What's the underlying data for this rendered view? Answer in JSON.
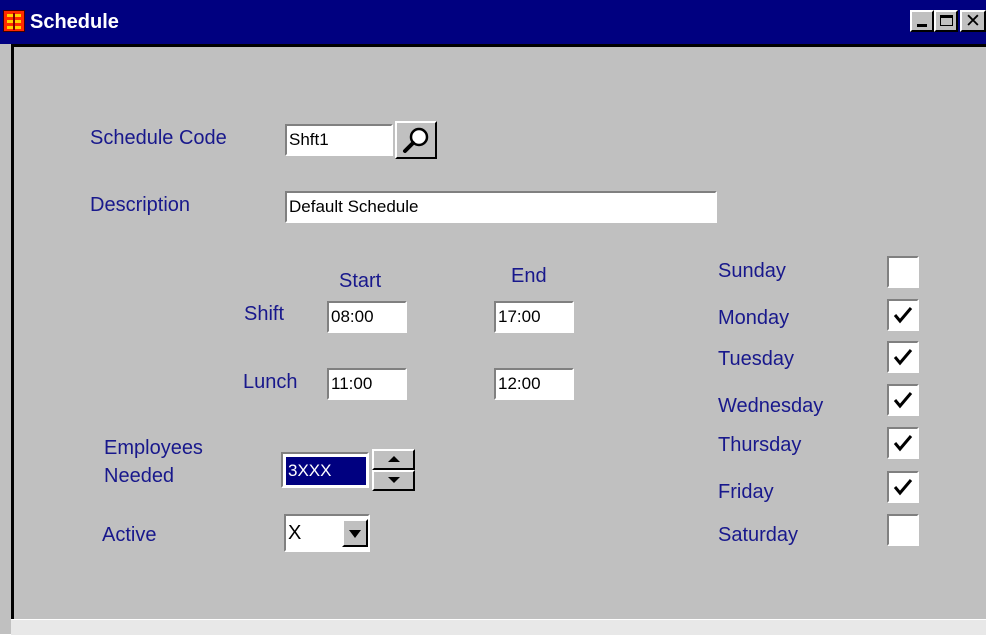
{
  "window": {
    "title": "Schedule",
    "title_bg": "#000080",
    "minimize_glyph": "minimize-icon",
    "maximize_glyph": "maximize-icon",
    "close_glyph": "✕"
  },
  "form": {
    "label_color": "#18188c",
    "schedule_code": {
      "label": "Schedule Code",
      "value": "Shft1",
      "lookup_icon": "magnifier-icon"
    },
    "description": {
      "label": "Description",
      "value": "Default Schedule"
    },
    "times": {
      "start_header": "Start",
      "end_header": "End",
      "shift": {
        "label": "Shift",
        "start": "08:00",
        "end": "17:00"
      },
      "lunch": {
        "label": "Lunch",
        "start": "11:00",
        "end": "12:00"
      }
    },
    "employees_needed": {
      "label_line1": "Employees",
      "label_line2": "Needed",
      "value": "3XXX"
    },
    "active": {
      "label": "Active",
      "value": "X"
    }
  },
  "days": [
    {
      "label": "Sunday",
      "checked": false
    },
    {
      "label": "Monday",
      "checked": true
    },
    {
      "label": "Tuesday",
      "checked": true
    },
    {
      "label": "Wednesday",
      "checked": true
    },
    {
      "label": "Thursday",
      "checked": true
    },
    {
      "label": "Friday",
      "checked": true
    },
    {
      "label": "Saturday",
      "checked": false
    }
  ]
}
